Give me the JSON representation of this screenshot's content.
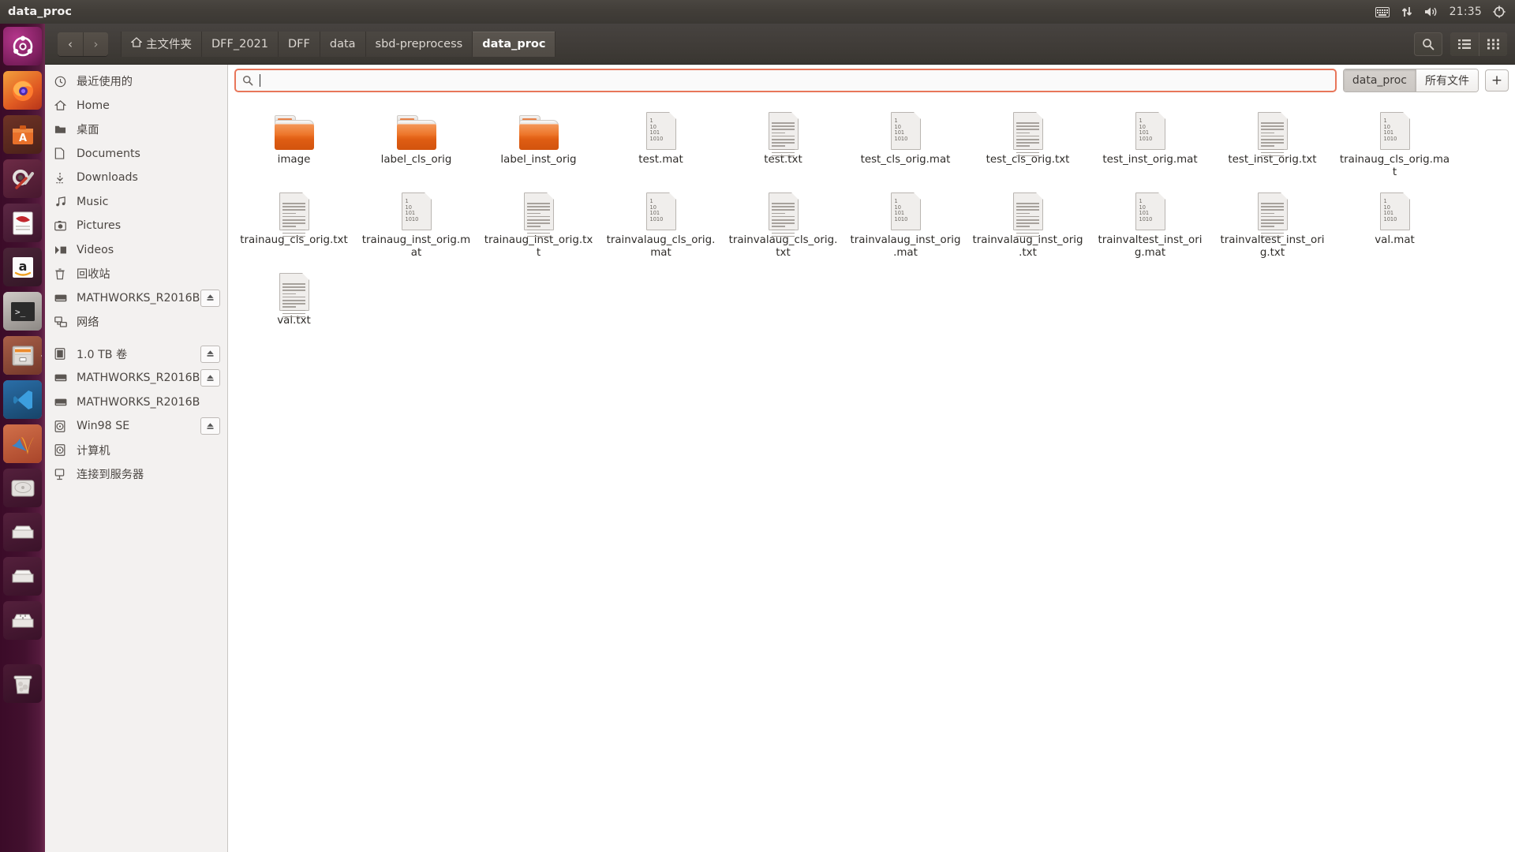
{
  "panel": {
    "title": "data_proc",
    "tray": {
      "keyboard_icon": "keyboard-icon",
      "network_icon": "network-updown-icon",
      "volume_icon": "volume-icon",
      "clock": "21:35",
      "power_icon": "power-gear-icon"
    }
  },
  "launcher": {
    "items": [
      {
        "name": "ubuntu-dash",
        "label": "Ubuntu Dash",
        "active": false
      },
      {
        "name": "firefox",
        "label": "Firefox",
        "active": false
      },
      {
        "name": "software-center",
        "label": "Ubuntu Software",
        "active": false
      },
      {
        "name": "system-settings",
        "label": "System Settings",
        "active": false
      },
      {
        "name": "libreoffice-writer",
        "label": "LibreOffice Writer",
        "active": false
      },
      {
        "name": "amazon",
        "label": "Amazon",
        "active": false
      },
      {
        "name": "terminal",
        "label": "Terminal",
        "active": true
      },
      {
        "name": "files",
        "label": "Files",
        "active": true
      },
      {
        "name": "vscode",
        "label": "Visual Studio Code",
        "active": true
      },
      {
        "name": "matlab",
        "label": "MATLAB",
        "active": true
      },
      {
        "name": "hard-disk",
        "label": "1.0 TB 卷",
        "active": false
      },
      {
        "name": "optical-drive-1",
        "label": "MATHWORKS_R2016B",
        "active": false
      },
      {
        "name": "optical-drive-2",
        "label": "MATHWORKS_R2016B",
        "active": false
      },
      {
        "name": "win98-drive",
        "label": "Win98 SE",
        "active": false
      },
      {
        "name": "trash",
        "label": "回收站",
        "active": false
      }
    ]
  },
  "toolbar": {
    "back_label": "‹",
    "forward_label": "›",
    "breadcrumbs": [
      {
        "label": "主文件夹",
        "home": true,
        "current": false
      },
      {
        "label": "DFF_2021",
        "home": false,
        "current": false
      },
      {
        "label": "DFF",
        "home": false,
        "current": false
      },
      {
        "label": "data",
        "home": false,
        "current": false
      },
      {
        "label": "sbd-preprocess",
        "home": false,
        "current": false
      },
      {
        "label": "data_proc",
        "home": false,
        "current": true
      }
    ],
    "search_icon": "search-icon",
    "list_view_icon": "list-view-icon",
    "grid_view_icon": "grid-view-icon"
  },
  "sidebar": {
    "items": [
      {
        "label": "最近使用的",
        "icon": "clock-icon",
        "eject": false,
        "sep_before": false
      },
      {
        "label": "Home",
        "icon": "home-icon",
        "eject": false,
        "sep_before": false
      },
      {
        "label": "桌面",
        "icon": "folder-icon",
        "eject": false,
        "sep_before": false
      },
      {
        "label": "Documents",
        "icon": "document-icon",
        "eject": false,
        "sep_before": false
      },
      {
        "label": "Downloads",
        "icon": "download-icon",
        "eject": false,
        "sep_before": false
      },
      {
        "label": "Music",
        "icon": "music-icon",
        "eject": false,
        "sep_before": false
      },
      {
        "label": "Pictures",
        "icon": "picture-icon",
        "eject": false,
        "sep_before": false
      },
      {
        "label": "Videos",
        "icon": "video-icon",
        "eject": false,
        "sep_before": false
      },
      {
        "label": "回收站",
        "icon": "trash-icon",
        "eject": false,
        "sep_before": false
      },
      {
        "label": "MATHWORKS_R2016B",
        "icon": "drive-icon",
        "eject": true,
        "sep_before": false
      },
      {
        "label": "网络",
        "icon": "network-icon",
        "eject": false,
        "sep_before": false
      },
      {
        "label": "1.0 TB 卷",
        "icon": "hdd-icon",
        "eject": true,
        "sep_before": true
      },
      {
        "label": "MATHWORKS_R2016B",
        "icon": "drive-icon",
        "eject": true,
        "sep_before": false
      },
      {
        "label": "MATHWORKS_R2016B",
        "icon": "drive-icon",
        "eject": false,
        "sep_before": false
      },
      {
        "label": "Win98 SE",
        "icon": "disc-icon",
        "eject": true,
        "sep_before": false
      },
      {
        "label": "计算机",
        "icon": "disc-icon",
        "eject": false,
        "sep_before": false
      },
      {
        "label": "连接到服务器",
        "icon": "server-icon",
        "eject": false,
        "sep_before": false
      }
    ]
  },
  "search": {
    "icon": "search-icon",
    "value": "",
    "placeholder": ""
  },
  "tabs": {
    "items": [
      {
        "label": "data_proc",
        "active": true
      },
      {
        "label": "所有文件",
        "active": false
      }
    ],
    "add_label": "+"
  },
  "files": [
    {
      "name": "image",
      "type": "folder"
    },
    {
      "name": "label_cls_orig",
      "type": "folder"
    },
    {
      "name": "label_inst_orig",
      "type": "folder"
    },
    {
      "name": "test.mat",
      "type": "mat"
    },
    {
      "name": "test.txt",
      "type": "txt"
    },
    {
      "name": "test_cls_orig.mat",
      "type": "mat"
    },
    {
      "name": "test_cls_orig.txt",
      "type": "txt"
    },
    {
      "name": "test_inst_orig.mat",
      "type": "mat"
    },
    {
      "name": "test_inst_orig.txt",
      "type": "txt"
    },
    {
      "name": "trainaug_cls_orig.mat",
      "type": "mat"
    },
    {
      "name": "trainaug_cls_orig.txt",
      "type": "txt"
    },
    {
      "name": "trainaug_inst_orig.mat",
      "type": "mat"
    },
    {
      "name": "trainaug_inst_orig.txt",
      "type": "txt"
    },
    {
      "name": "trainvalaug_cls_orig.mat",
      "type": "mat"
    },
    {
      "name": "trainvalaug_cls_orig.txt",
      "type": "txt"
    },
    {
      "name": "trainvalaug_inst_orig.mat",
      "type": "mat"
    },
    {
      "name": "trainvalaug_inst_orig.txt",
      "type": "txt"
    },
    {
      "name": "trainvaltest_inst_orig.mat",
      "type": "mat"
    },
    {
      "name": "trainvaltest_inst_orig.txt",
      "type": "txt"
    },
    {
      "name": "val.mat",
      "type": "mat"
    },
    {
      "name": "val.txt",
      "type": "txt"
    }
  ],
  "icon_text": {
    "binary_lines": [
      "1",
      "10",
      "101",
      "1010"
    ]
  },
  "colors": {
    "accent_orange": "#e8765a",
    "folder_orange": "#ec6f20",
    "panel_dark": "#413d38",
    "launcher_purple": "#42102e",
    "sidebar_bg": "#f3f1f0"
  }
}
